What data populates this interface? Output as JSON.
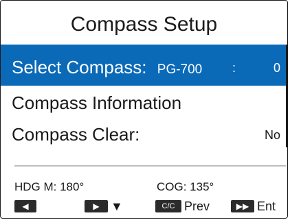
{
  "title": "Compass Setup",
  "menu": {
    "select": {
      "label": "Select Compass:",
      "model": "PG-700",
      "sep": ":",
      "value": "0"
    },
    "info": {
      "label": "Compass Information"
    },
    "clear": {
      "label": "Compass Clear:",
      "value": "No"
    }
  },
  "status": {
    "hdg": "HDG M: 180°",
    "cog": "COG: 135°"
  },
  "softkeys": [
    {
      "icon": "◀"
    },
    {
      "icon": "▶",
      "label": "▼"
    },
    {
      "icon": "C/C",
      "label": "Prev"
    },
    {
      "icon": "▶▶",
      "label": "Ent"
    }
  ]
}
